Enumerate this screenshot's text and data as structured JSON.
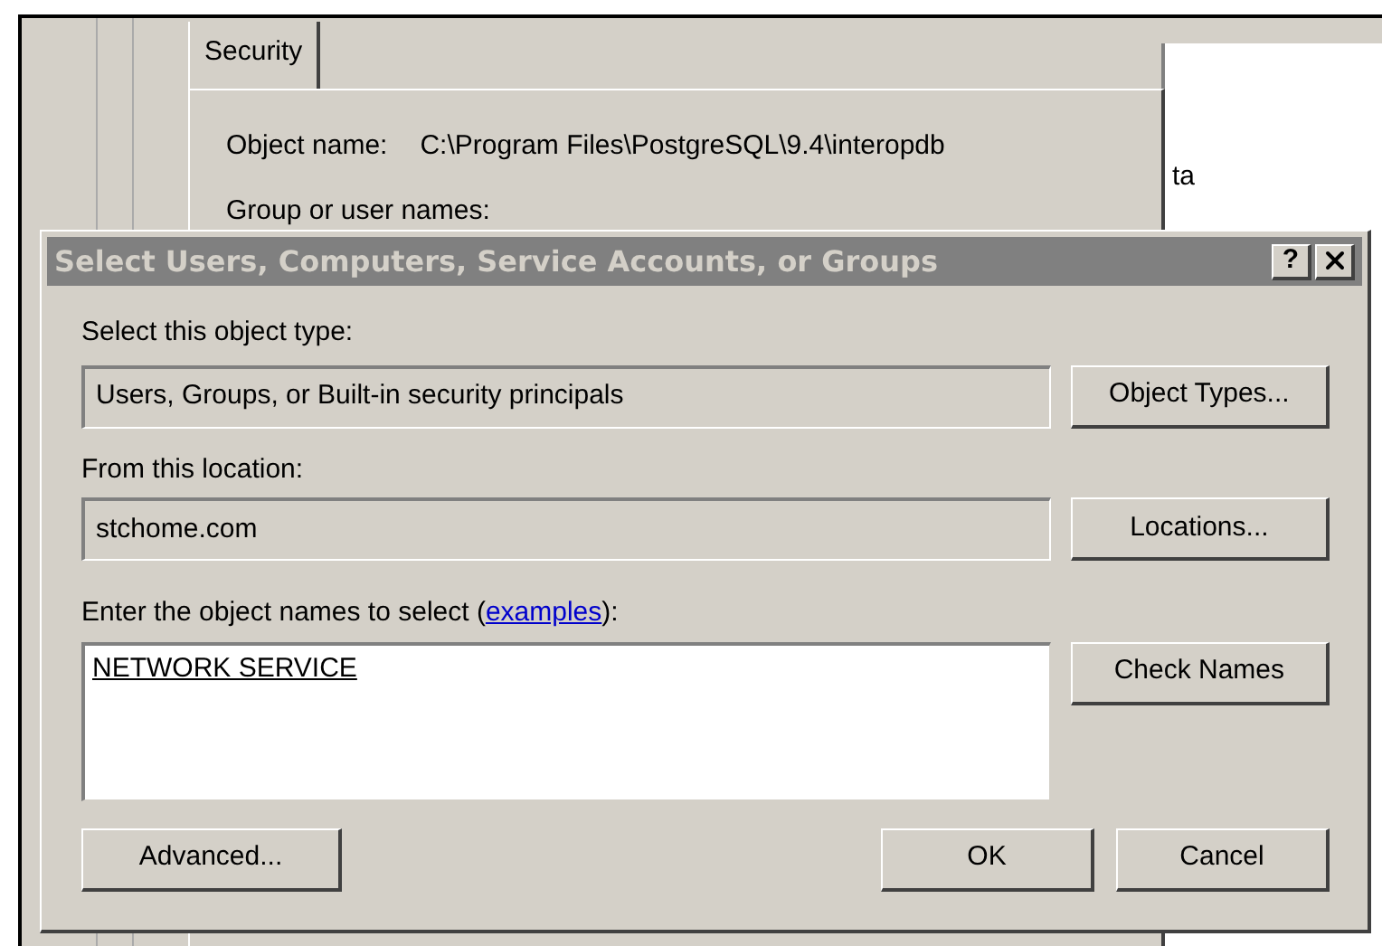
{
  "background_window": {
    "tab": {
      "label": "Security",
      "selected": true
    },
    "object_name_label": "Object name:",
    "object_name_value": "C:\\Program Files\\PostgreSQL\\9.4\\interopdb",
    "group_label": "Group or user names:"
  },
  "side_panel": {
    "text": "ta"
  },
  "dialog": {
    "title": "Select Users, Computers, Service Accounts, or Groups",
    "help_button": "?",
    "object_type": {
      "label": "Select this object type:",
      "value": "Users, Groups, or Built-in security principals",
      "button": "Object Types..."
    },
    "location": {
      "label": "From this location:",
      "value": "stchome.com",
      "button": "Locations..."
    },
    "names": {
      "label": "Enter the object names to select (",
      "link": "examples",
      "label_end": "):",
      "value": "NETWORK SERVICE",
      "button": "Check Names"
    },
    "buttons": {
      "advanced": "Advanced...",
      "ok": "OK",
      "cancel": "Cancel"
    }
  }
}
